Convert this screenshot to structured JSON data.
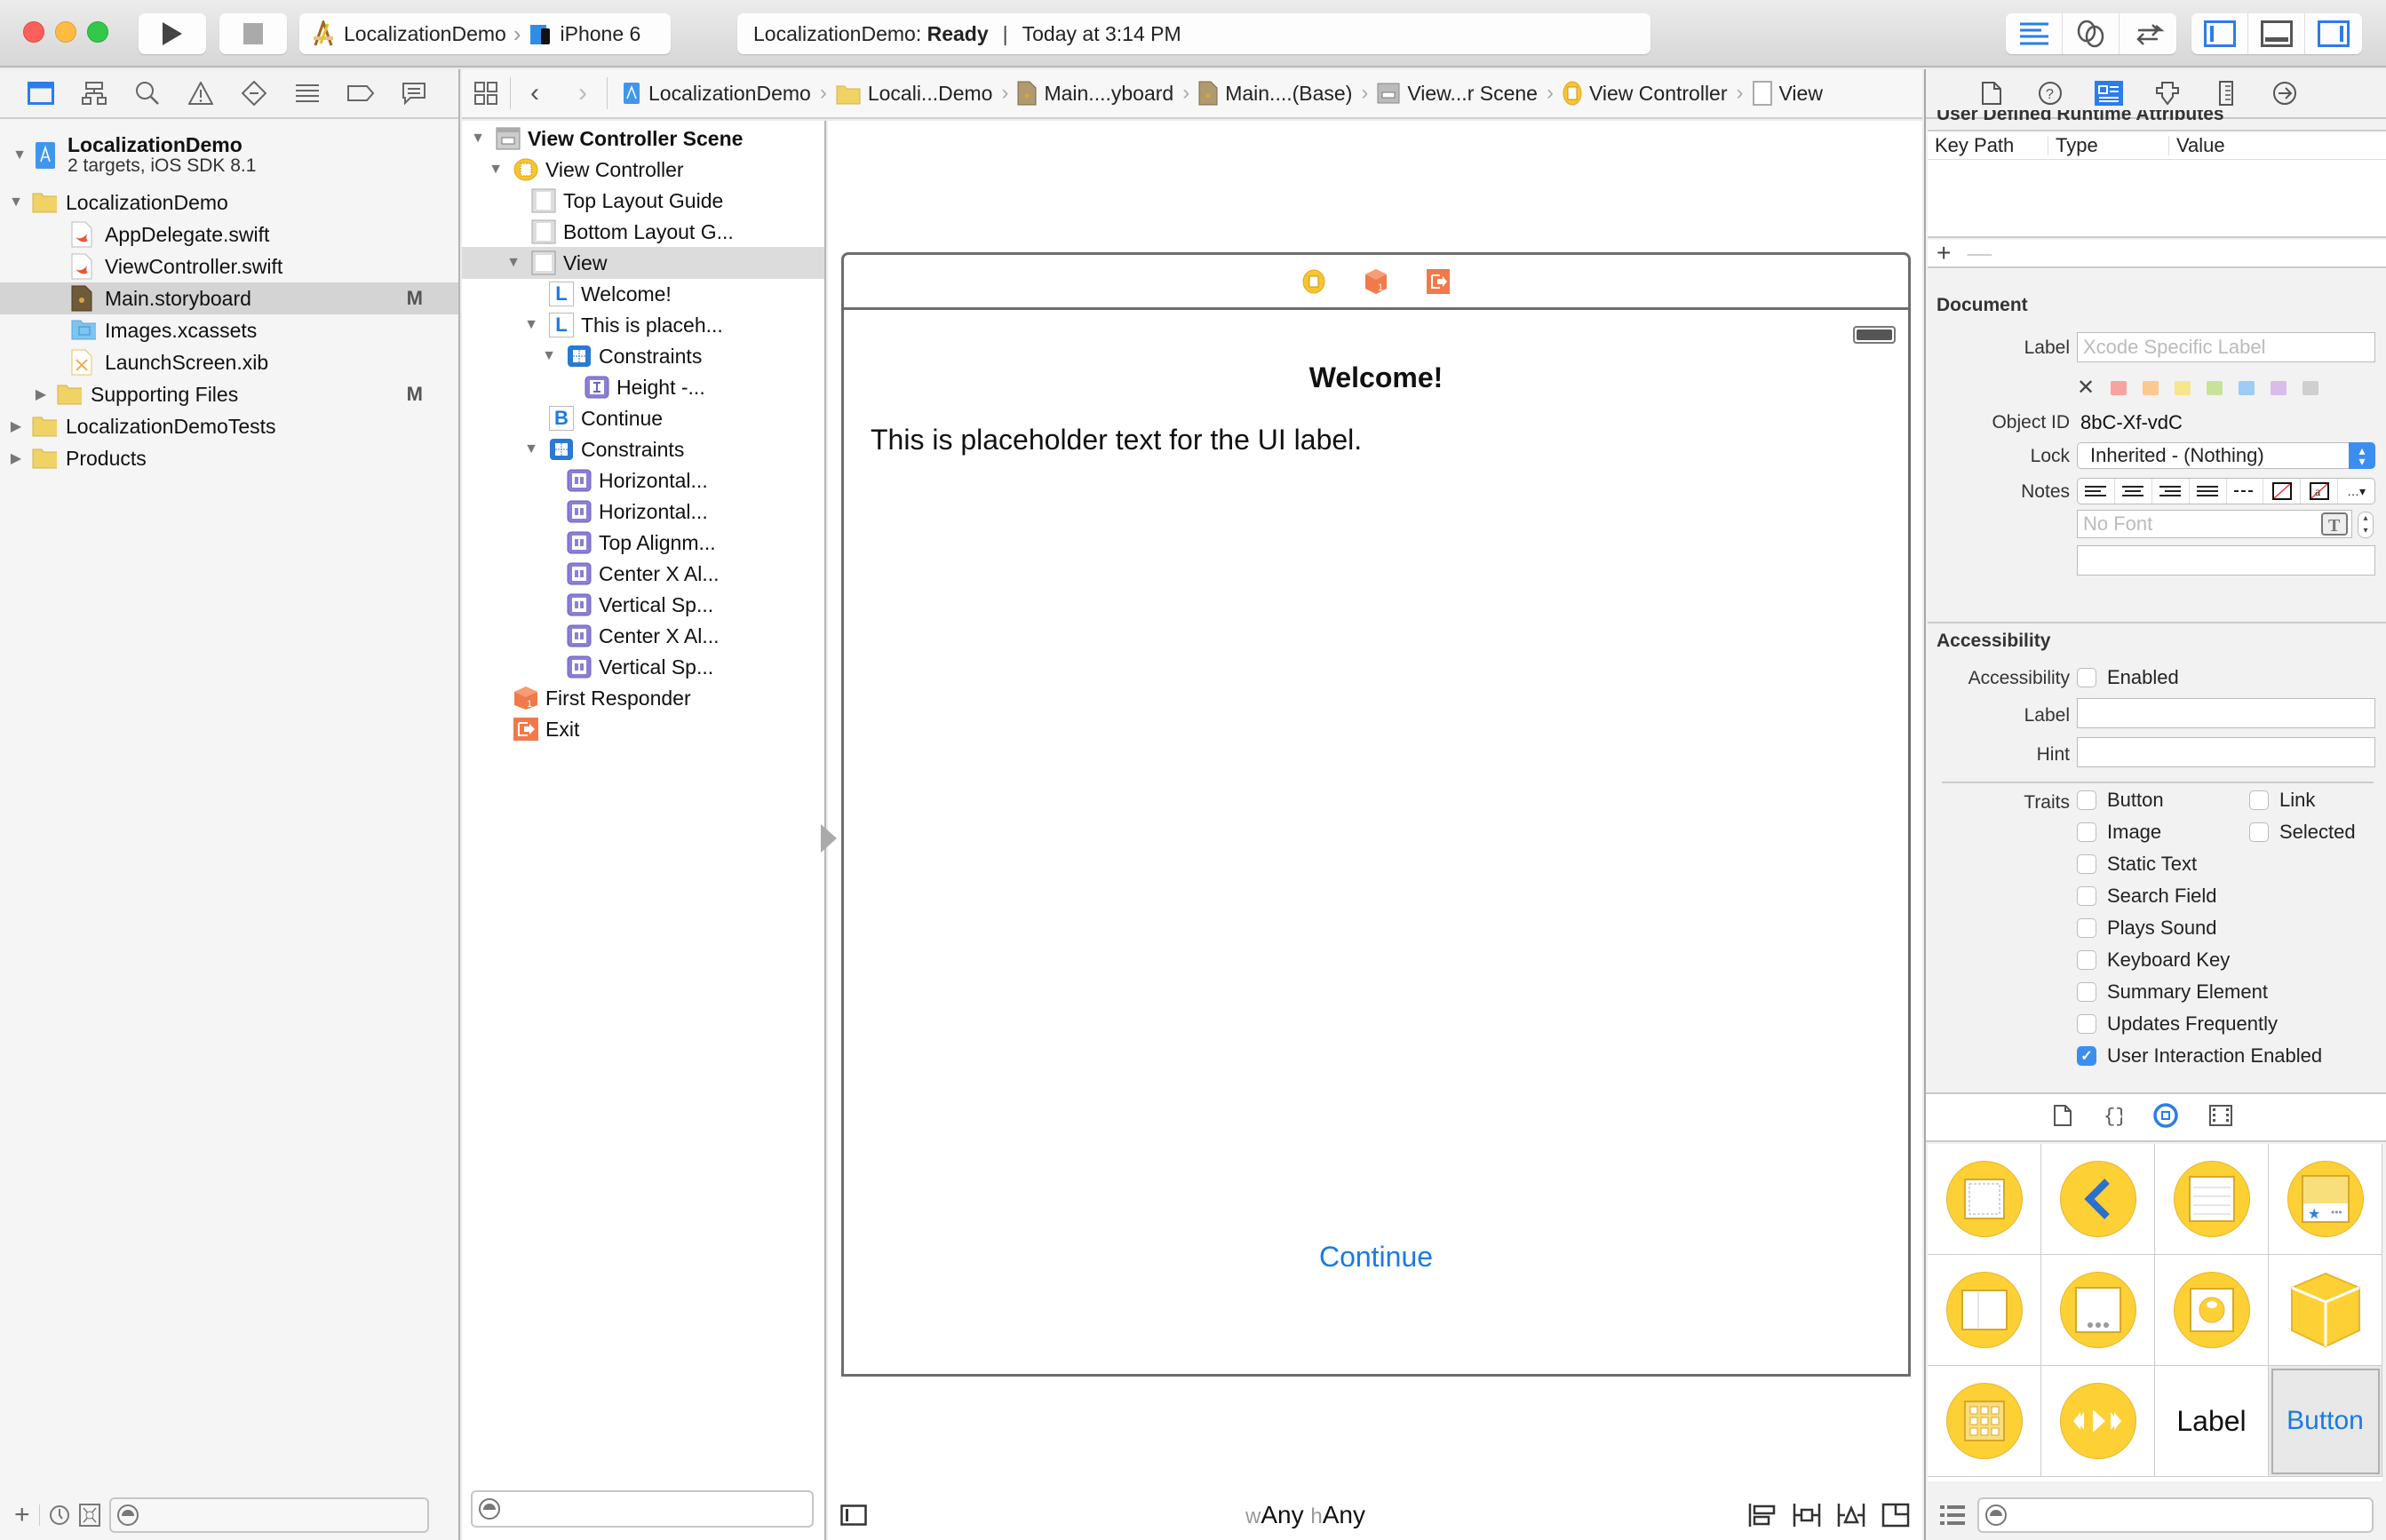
{
  "window": {
    "scheme": {
      "project": "LocalizationDemo",
      "device": "iPhone 6"
    },
    "status": {
      "project": "LocalizationDemo:",
      "state": "Ready",
      "time": "Today at 3:14 PM"
    },
    "editor_modes": [
      "standard-editor-icon",
      "assistant-editor-icon",
      "version-editor-icon"
    ],
    "view_toggles": [
      "navigator-toggle-icon",
      "debug-area-toggle-icon",
      "utilities-toggle-icon"
    ]
  },
  "navigator": {
    "tabs": [
      "project-navigator-icon",
      "symbol-navigator-icon",
      "find-navigator-icon",
      "issue-navigator-icon",
      "test-navigator-icon",
      "debug-navigator-icon",
      "breakpoint-navigator-icon",
      "report-navigator-icon"
    ],
    "project": {
      "name": "LocalizationDemo",
      "subtitle": "2 targets, iOS SDK 8.1"
    },
    "items": [
      {
        "label": "LocalizationDemo",
        "type": "folder",
        "indent": 1,
        "disclosure": "open",
        "badge": ""
      },
      {
        "label": "AppDelegate.swift",
        "type": "swift",
        "indent": 2,
        "disclosure": "",
        "badge": ""
      },
      {
        "label": "ViewController.swift",
        "type": "swift",
        "indent": 2,
        "disclosure": "",
        "badge": ""
      },
      {
        "label": "Main.storyboard",
        "type": "storyboard",
        "indent": 2,
        "disclosure": "",
        "badge": "M",
        "selected": true
      },
      {
        "label": "Images.xcassets",
        "type": "xcassets",
        "indent": 2,
        "disclosure": "",
        "badge": ""
      },
      {
        "label": "LaunchScreen.xib",
        "type": "xib",
        "indent": 2,
        "disclosure": "",
        "badge": ""
      },
      {
        "label": "Supporting Files",
        "type": "folder",
        "indent": 2,
        "disclosure": "closed",
        "badge": "M"
      },
      {
        "label": "LocalizationDemoTests",
        "type": "folder",
        "indent": 1,
        "disclosure": "closed",
        "badge": ""
      },
      {
        "label": "Products",
        "type": "folder",
        "indent": 1,
        "disclosure": "closed",
        "badge": ""
      }
    ],
    "filter_placeholder": ""
  },
  "jumpbar": {
    "crumbs": [
      "LocalizationDemo",
      "Locali...Demo",
      "Main....yboard",
      "Main....(Base)",
      "View...r Scene",
      "View Controller",
      "View"
    ]
  },
  "outline": {
    "items": [
      {
        "label": "View Controller Scene",
        "icon": "scene",
        "level": 0,
        "disclosure": "open",
        "bold": true
      },
      {
        "label": "View Controller",
        "icon": "view-controller",
        "level": 1,
        "disclosure": "open"
      },
      {
        "label": "Top Layout Guide",
        "icon": "layout-guide",
        "level": 2,
        "disclosure": ""
      },
      {
        "label": "Bottom Layout G...",
        "icon": "layout-guide",
        "level": 2,
        "disclosure": ""
      },
      {
        "label": "View",
        "icon": "view",
        "level": 2,
        "disclosure": "open",
        "selected": true
      },
      {
        "label": "Welcome!",
        "icon": "label",
        "level": 3,
        "disclosure": ""
      },
      {
        "label": "This is placeh...",
        "icon": "label",
        "level": 3,
        "disclosure": "open"
      },
      {
        "label": "Constraints",
        "icon": "constraints",
        "level": 4,
        "disclosure": "open"
      },
      {
        "label": "Height -...",
        "icon": "constraint-height",
        "level": 5,
        "disclosure": ""
      },
      {
        "label": "Continue",
        "icon": "button",
        "level": 3,
        "disclosure": ""
      },
      {
        "label": "Constraints",
        "icon": "constraints",
        "level": 3,
        "disclosure": "open"
      },
      {
        "label": "Horizontal...",
        "icon": "constraint",
        "level": 4,
        "disclosure": ""
      },
      {
        "label": "Horizontal...",
        "icon": "constraint",
        "level": 4,
        "disclosure": ""
      },
      {
        "label": "Top Alignm...",
        "icon": "constraint",
        "level": 4,
        "disclosure": ""
      },
      {
        "label": "Center X Al...",
        "icon": "constraint",
        "level": 4,
        "disclosure": ""
      },
      {
        "label": "Vertical Sp...",
        "icon": "constraint",
        "level": 4,
        "disclosure": ""
      },
      {
        "label": "Center X Al...",
        "icon": "constraint",
        "level": 4,
        "disclosure": ""
      },
      {
        "label": "Vertical Sp...",
        "icon": "constraint",
        "level": 4,
        "disclosure": ""
      },
      {
        "label": "First Responder",
        "icon": "first-responder",
        "level": 1,
        "disclosure": ""
      },
      {
        "label": "Exit",
        "icon": "exit",
        "level": 1,
        "disclosure": ""
      }
    ]
  },
  "canvas": {
    "welcome_label": "Welcome!",
    "placeholder_label": "This is placeholder text for the UI label.",
    "continue_button": "Continue",
    "size_class": {
      "w_prefix": "w",
      "w_value": "Any",
      "h_prefix": "h",
      "h_value": "Any"
    }
  },
  "inspector": {
    "udra": {
      "title": "User Defined Runtime Attributes",
      "columns": [
        "Key Path",
        "Type",
        "Value"
      ],
      "add": "+",
      "remove": "—"
    },
    "document": {
      "title": "Document",
      "label_label": "Label",
      "label_placeholder": "Xcode Specific Label",
      "label_colors": [
        "#f7a3a0",
        "#f9c98d",
        "#f8e68a",
        "#c9e29a",
        "#9fcbf6",
        "#d8bde8",
        "#cfcfcf"
      ],
      "object_id_label": "Object ID",
      "object_id": "8bC-Xf-vdC",
      "lock_label": "Lock",
      "lock_value": "Inherited - (Nothing)",
      "notes_label": "Notes",
      "font_placeholder": "No Font"
    },
    "accessibility": {
      "title": "Accessibility",
      "accessibility_label": "Accessibility",
      "enabled_label": "Enabled",
      "enabled": false,
      "label_label": "Label",
      "hint_label": "Hint",
      "traits_label": "Traits",
      "traits": [
        {
          "label": "Button",
          "checked": false
        },
        {
          "label": "Link",
          "checked": false
        },
        {
          "label": "Image",
          "checked": false
        },
        {
          "label": "Selected",
          "checked": false
        },
        {
          "label": "Static Text",
          "checked": false
        },
        {
          "label": "Search Field",
          "checked": false
        },
        {
          "label": "Plays Sound",
          "checked": false
        },
        {
          "label": "Keyboard Key",
          "checked": false
        },
        {
          "label": "Summary Element",
          "checked": false
        },
        {
          "label": "Updates Frequently",
          "checked": false
        },
        {
          "label": "User Interaction Enabled",
          "checked": true
        }
      ]
    },
    "library": {
      "tabs": [
        "file-template-library-icon",
        "code-snippet-library-icon",
        "object-library-icon",
        "media-library-icon"
      ],
      "items": [
        "view-controller",
        "navigation-controller",
        "table-view-controller",
        "tab-bar-controller",
        "split-view-controller",
        "page-view-controller",
        "glkit-view-controller",
        "object",
        "collection-view-controller",
        "av-player-view-controller",
        "Label",
        "Button"
      ]
    }
  }
}
